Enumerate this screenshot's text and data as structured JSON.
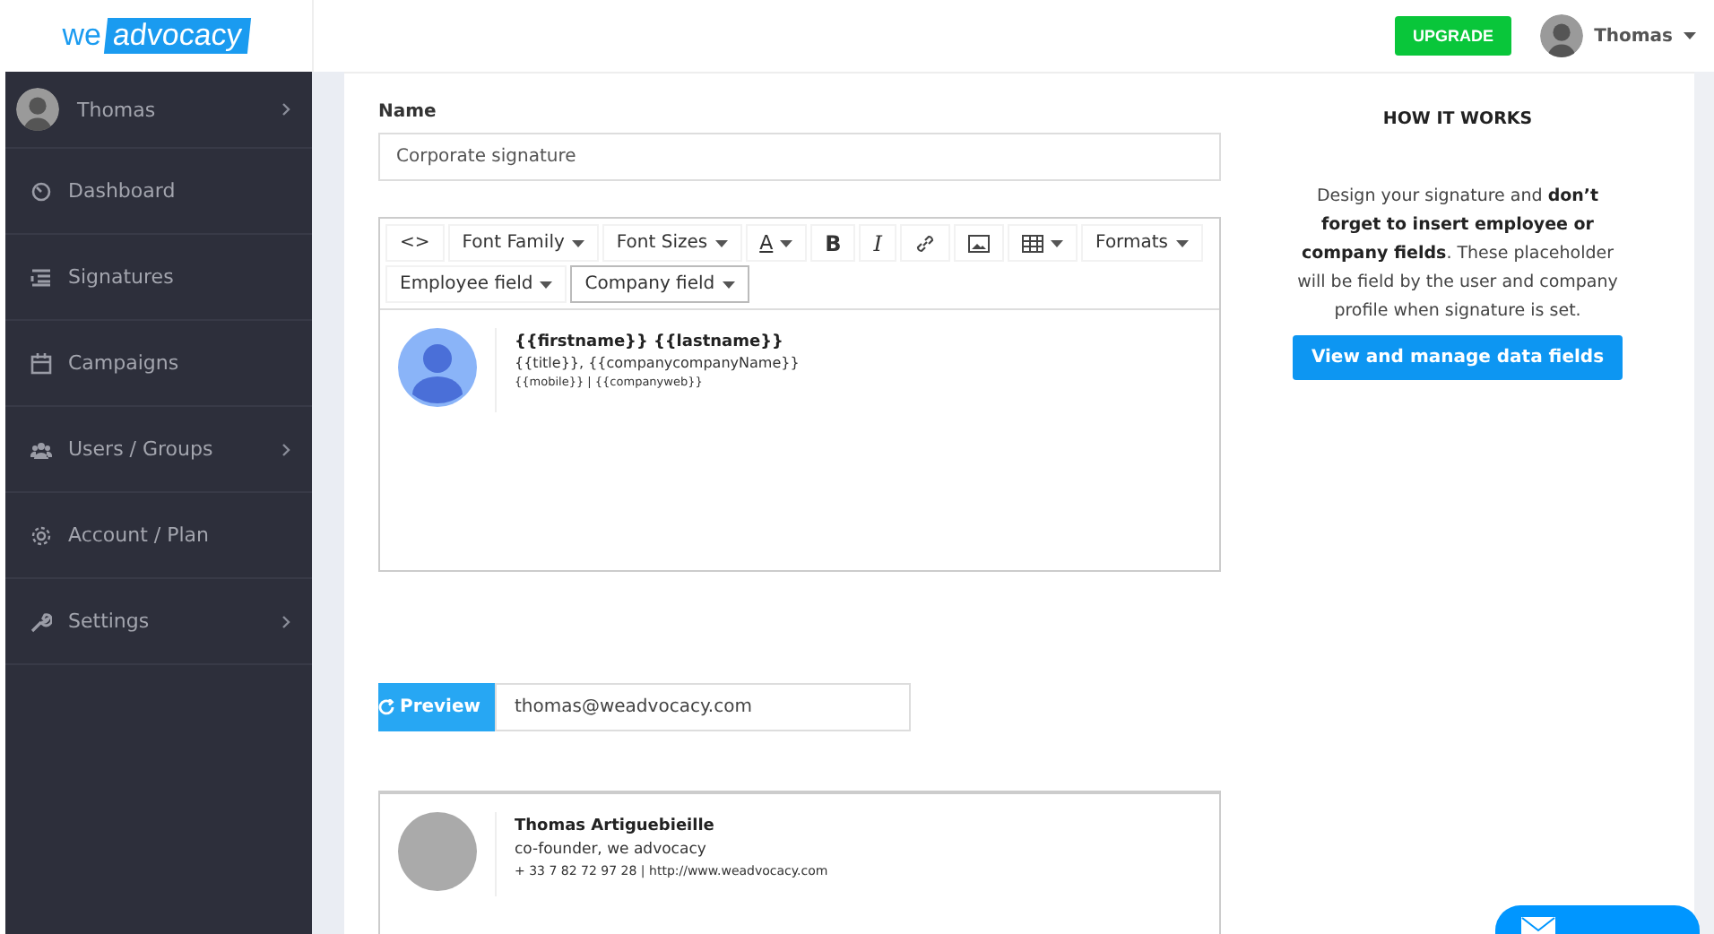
{
  "header": {
    "logo": {
      "part_1": "we",
      "part_2": "advocacy"
    },
    "upgrade_button": "UPGRADE",
    "user_menu": "Thomas"
  },
  "sidebar": {
    "user": {
      "name": "Thomas",
      "has_submenu": true
    },
    "items": [
      {
        "label": "Dashboard",
        "has_submenu": false
      },
      {
        "label": "Signatures",
        "has_submenu": false
      },
      {
        "label": "Campaigns",
        "has_submenu": false
      },
      {
        "label": "Users / Groups",
        "has_submenu": true
      },
      {
        "label": "Account / Plan",
        "has_submenu": false
      },
      {
        "label": "Settings",
        "has_submenu": true
      }
    ]
  },
  "form": {
    "name_label": "Name",
    "name_value": "Corporate signature",
    "toolbar": [
      {
        "kind": "glyph",
        "label": "<>",
        "pressed": false
      },
      {
        "kind": "dropdown",
        "label": "Font Family",
        "pressed": false
      },
      {
        "kind": "dropdown",
        "label": "Font Sizes",
        "pressed": false
      },
      {
        "kind": "color",
        "label": "A",
        "pressed": false
      },
      {
        "kind": "bold",
        "label": "B",
        "pressed": false
      },
      {
        "kind": "italic",
        "label": "I",
        "pressed": false
      },
      {
        "kind": "link",
        "pressed": false
      },
      {
        "kind": "image",
        "pressed": false
      },
      {
        "kind": "table",
        "pressed": false
      },
      {
        "kind": "dropdown",
        "label": "Formats",
        "pressed": false
      },
      {
        "kind": "dropdown",
        "label": "Employee field",
        "pressed": false
      },
      {
        "kind": "dropdown",
        "label": "Company field",
        "pressed": true
      }
    ],
    "template": {
      "name": "{{firstname}} {{lastname}}",
      "line_1": "{{title}}, {{companycompanyName}}",
      "line_2": "{{mobile}} | {{companyweb}}"
    }
  },
  "preview": {
    "button": "Preview",
    "email": "thomas@weadvocacy.com",
    "signature": {
      "name": "Thomas Artiguebieille",
      "role": "co-founder, we advocacy",
      "contact": "+ 33 7 82 72 97 28 | http://www.weadvocacy.com"
    }
  },
  "help": {
    "title": "HOW IT WORKS",
    "text": "Design your signature and **don’t forget to insert employee or company fields**. These placeholder will be field by the user and company profile when signature is set.",
    "button": "View and manage data fields"
  }
}
